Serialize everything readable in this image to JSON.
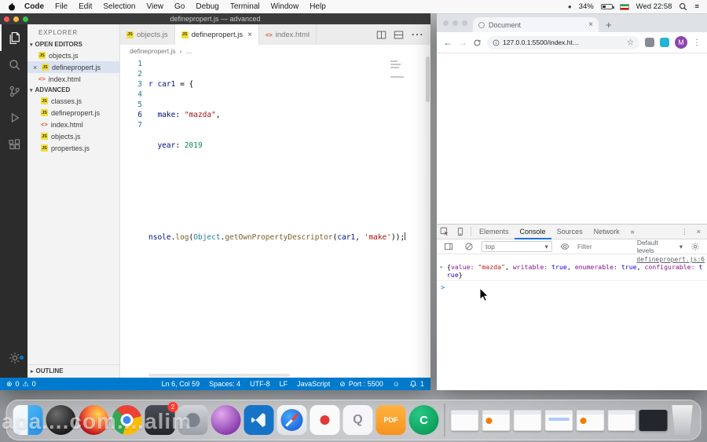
{
  "icons": {
    "record_dot": "●",
    "hamburger": "≡",
    "chevron_down": "▾",
    "chevron_right": "▸",
    "close": "×",
    "js_badge": "JS",
    "html_badge": "<>",
    "more": "⋯",
    "kebab": "⋮",
    "breadcrumb_sep": "›",
    "error": "⊗",
    "warning": "⚠",
    "blocked": "⊘",
    "smiley": "☺",
    "back": "←",
    "forward": "→",
    "star": "☆",
    "plus": "+",
    "dropdown": "▾",
    "expand": "▸"
  },
  "menubar": {
    "app_name": "Code",
    "items": [
      "File",
      "Edit",
      "Selection",
      "View",
      "Go",
      "Debug",
      "Terminal",
      "Window",
      "Help"
    ],
    "battery": "34%",
    "clock": "Wed 22:58"
  },
  "vscode": {
    "title": "definepropert.js — advanced",
    "explorer": {
      "heading": "EXPLORER",
      "open_editors_label": "OPEN EDITORS",
      "open_editors": [
        {
          "name": "objects.js"
        },
        {
          "name": "definepropert.js"
        },
        {
          "name": "index.html"
        }
      ],
      "folder_label": "ADVANCED",
      "files": [
        {
          "name": "classes.js"
        },
        {
          "name": "definepropert.js"
        },
        {
          "name": "index.html"
        },
        {
          "name": "objects.js"
        },
        {
          "name": "properties.js"
        }
      ],
      "outline_label": "OUTLINE"
    },
    "tabs": [
      {
        "label": "objects.js"
      },
      {
        "label": "definepropert.js"
      },
      {
        "label": "index.html"
      }
    ],
    "breadcrumb": {
      "file": "definepropert.js",
      "ellipsis": "…"
    },
    "code": {
      "nums": [
        "1",
        "2",
        "3",
        "4",
        "5",
        "6",
        "7"
      ],
      "l1": {
        "a": "r ",
        "b": "car1 ",
        "c": "= {"
      },
      "l2": {
        "a": "  make",
        "b": ": ",
        "c": "\"mazda\"",
        "d": ","
      },
      "l3": {
        "a": "  year",
        "b": ": ",
        "c": "2019"
      },
      "l6": {
        "a": "nsole",
        "b": ".",
        "c": "log",
        "d": "(",
        "e": "Object",
        "f": ".",
        "g": "getOwnPropertyDescriptor",
        "h": "(",
        "i": "car1",
        "j": ", ",
        "k": "'make'",
        "l": "));"
      }
    },
    "status": {
      "errors": "0",
      "warnings": "0",
      "cursor": "Ln 6, Col 59",
      "indent": "Spaces: 4",
      "encoding": "UTF-8",
      "eol": "LF",
      "lang": "JavaScript",
      "port": "Port : 5500",
      "bell": "1"
    }
  },
  "chrome": {
    "tab_title": "Document",
    "address": "127.0.0.1:5500/index.ht…",
    "avatar": "M",
    "devtools": {
      "tabs": [
        "Elements",
        "Console",
        "Sources",
        "Network"
      ],
      "more_tabs": "»",
      "context": "top",
      "filter_placeholder": "Filter",
      "levels": "Default levels",
      "source_link": "definepropert.js:6",
      "log": {
        "open": "{",
        "k1": "value: ",
        "v1": "\"mazda\"",
        "c1": ", ",
        "k2": "writable: ",
        "v2": "true",
        "c2": ", ",
        "k3": "enumerable: ",
        "v3": "true",
        "c3": ", ",
        "k4": "configurable: ",
        "v4": "t",
        "wrap": "rue",
        "close": "}"
      },
      "prompt": ">"
    }
  },
  "dock": {
    "badge": "2",
    "quicktime_label": "Q",
    "pdf_label": "PDF",
    "camtasia_label": "C"
  },
  "watermark": "apa....com....alim"
}
